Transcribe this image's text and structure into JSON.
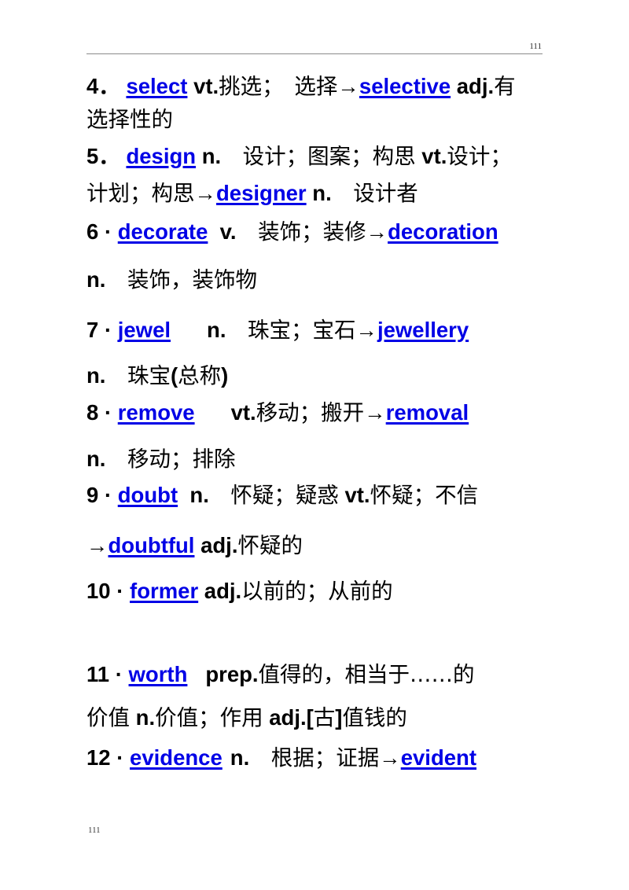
{
  "document": {
    "header": {
      "page_number": "111"
    },
    "footer": {
      "page_number": "111"
    },
    "colors": {
      "keyword_blue": "#0000e6",
      "text_black": "#000000",
      "rule_gray": "#8a8a8a"
    },
    "arrow_glyph": "→",
    "entries": [
      {
        "index": "4",
        "separator": "．",
        "headword": "select",
        "lines": [
          {
            "parts": [
              {
                "t": "num",
                "v": "4"
              },
              {
                "t": "sep",
                "v": "．"
              },
              {
                "t": "sp",
                "v": " "
              },
              {
                "t": "kw",
                "v": "select"
              },
              {
                "t": "sp",
                "v": " "
              },
              {
                "t": "pos",
                "v": "vt."
              },
              {
                "t": "cn",
                "v": "挑选；　选择"
              },
              {
                "t": "arr",
                "v": "→"
              },
              {
                "t": "kw",
                "v": "selective"
              },
              {
                "t": "sp",
                "v": " "
              },
              {
                "t": "pos",
                "v": "adj."
              },
              {
                "t": "cn",
                "v": "有"
              }
            ]
          },
          {
            "parts": [
              {
                "t": "cn",
                "v": "选择性的"
              }
            ]
          }
        ]
      },
      {
        "index": "5",
        "separator": "．",
        "headword": "design",
        "lines": [
          {
            "parts": [
              {
                "t": "num",
                "v": "5"
              },
              {
                "t": "sep",
                "v": "．"
              },
              {
                "t": "sp",
                "v": " "
              },
              {
                "t": "kw",
                "v": "design"
              },
              {
                "t": "sp",
                "v": " "
              },
              {
                "t": "pos",
                "v": "n."
              },
              {
                "t": "cn",
                "v": "　设计；图案；构思"
              },
              {
                "t": "sp",
                "v": " "
              },
              {
                "t": "pos",
                "v": "vt."
              },
              {
                "t": "cn",
                "v": "设计；"
              }
            ]
          },
          {
            "parts": [
              {
                "t": "cn",
                "v": "计划；构思"
              },
              {
                "t": "arr",
                "v": "→"
              },
              {
                "t": "kw",
                "v": "designer"
              },
              {
                "t": "sp",
                "v": " "
              },
              {
                "t": "pos",
                "v": "n."
              },
              {
                "t": "cn",
                "v": "　设计者"
              }
            ]
          }
        ]
      },
      {
        "index": "6",
        "separator": "·",
        "headword": "decorate",
        "lines": [
          {
            "parts": [
              {
                "t": "num",
                "v": "6"
              },
              {
                "t": "sp",
                "v": " "
              },
              {
                "t": "sep",
                "v": "·"
              },
              {
                "t": "sp",
                "v": " "
              },
              {
                "t": "kw",
                "v": "decorate"
              },
              {
                "t": "sp",
                "v": "  "
              },
              {
                "t": "pos",
                "v": "v."
              },
              {
                "t": "cn",
                "v": "　装饰；装修"
              },
              {
                "t": "arr",
                "v": "→"
              },
              {
                "t": "kw",
                "v": "decoration"
              }
            ]
          },
          {
            "parts": [
              {
                "t": "pos",
                "v": "n."
              },
              {
                "t": "cn",
                "v": "　装饰，装饰物"
              }
            ]
          }
        ]
      },
      {
        "index": "7",
        "separator": "·",
        "headword": "jewel",
        "lines": [
          {
            "parts": [
              {
                "t": "num",
                "v": "7"
              },
              {
                "t": "sp",
                "v": " "
              },
              {
                "t": "sep",
                "v": "·"
              },
              {
                "t": "sp",
                "v": " "
              },
              {
                "t": "kw",
                "v": "jewel"
              },
              {
                "t": "gapmd",
                "v": ""
              },
              {
                "t": "pos",
                "v": "n."
              },
              {
                "t": "cn",
                "v": "　珠宝；宝石"
              },
              {
                "t": "arr",
                "v": "→"
              },
              {
                "t": "kw",
                "v": "jewellery"
              }
            ]
          },
          {
            "parts": [
              {
                "t": "pos",
                "v": "n."
              },
              {
                "t": "cn",
                "v": "　珠宝"
              },
              {
                "t": "pos",
                "v": "("
              },
              {
                "t": "cn",
                "v": "总称"
              },
              {
                "t": "pos",
                "v": ")"
              }
            ]
          }
        ]
      },
      {
        "index": "8",
        "separator": "·",
        "headword": "remove",
        "lines": [
          {
            "parts": [
              {
                "t": "num",
                "v": "8"
              },
              {
                "t": "sp",
                "v": " "
              },
              {
                "t": "sep",
                "v": "·"
              },
              {
                "t": "sp",
                "v": " "
              },
              {
                "t": "kw",
                "v": "remove"
              },
              {
                "t": "gapmd",
                "v": ""
              },
              {
                "t": "pos",
                "v": "vt."
              },
              {
                "t": "cn",
                "v": "移动；搬开"
              },
              {
                "t": "arr",
                "v": "→"
              },
              {
                "t": "kw",
                "v": "removal"
              }
            ]
          },
          {
            "parts": [
              {
                "t": "pos",
                "v": "n."
              },
              {
                "t": "cn",
                "v": "　移动；排除"
              }
            ]
          }
        ]
      },
      {
        "index": "9",
        "separator": "·",
        "headword": "doubt",
        "lines": [
          {
            "parts": [
              {
                "t": "num",
                "v": "9"
              },
              {
                "t": "sp",
                "v": " "
              },
              {
                "t": "sep",
                "v": "·"
              },
              {
                "t": "sp",
                "v": " "
              },
              {
                "t": "kw",
                "v": "doubt"
              },
              {
                "t": "sp",
                "v": "  "
              },
              {
                "t": "pos",
                "v": "n."
              },
              {
                "t": "cn",
                "v": "　怀疑；疑惑"
              },
              {
                "t": "sp",
                "v": " "
              },
              {
                "t": "pos",
                "v": "vt."
              },
              {
                "t": "cn",
                "v": "怀疑；不信"
              }
            ]
          },
          {
            "parts": [
              {
                "t": "arr",
                "v": "→"
              },
              {
                "t": "kw",
                "v": "doubtful"
              },
              {
                "t": "sp",
                "v": " "
              },
              {
                "t": "pos",
                "v": "adj."
              },
              {
                "t": "cn",
                "v": "怀疑的"
              }
            ]
          }
        ]
      },
      {
        "index": "10",
        "separator": "·",
        "headword": "former",
        "lines": [
          {
            "parts": [
              {
                "t": "num",
                "v": "10"
              },
              {
                "t": "sp",
                "v": " "
              },
              {
                "t": "sep",
                "v": "·"
              },
              {
                "t": "sp",
                "v": " "
              },
              {
                "t": "kw",
                "v": "former"
              },
              {
                "t": "sp",
                "v": " "
              },
              {
                "t": "pos",
                "v": "adj."
              },
              {
                "t": "cn",
                "v": "以前的；从前的"
              }
            ]
          }
        ]
      },
      {
        "index": "11",
        "separator": "·",
        "headword": "worth",
        "lines": [
          {
            "parts": [
              {
                "t": "num",
                "v": "11"
              },
              {
                "t": "sp",
                "v": " "
              },
              {
                "t": "sep",
                "v": "·"
              },
              {
                "t": "sp",
                "v": " "
              },
              {
                "t": "kw",
                "v": "worth"
              },
              {
                "t": "sp",
                "v": "   "
              },
              {
                "t": "pos",
                "v": "prep."
              },
              {
                "t": "cn",
                "v": "值得的，相当于……的"
              }
            ]
          },
          {
            "parts": [
              {
                "t": "cn",
                "v": "价值"
              },
              {
                "t": "sp",
                "v": " "
              },
              {
                "t": "pos",
                "v": "n."
              },
              {
                "t": "cn",
                "v": "价值；作用"
              },
              {
                "t": "sp",
                "v": " "
              },
              {
                "t": "pos",
                "v": "adj.["
              },
              {
                "t": "cn",
                "v": "古"
              },
              {
                "t": "pos",
                "v": "]"
              },
              {
                "t": "cn",
                "v": "值钱的"
              }
            ]
          }
        ]
      },
      {
        "index": "12",
        "separator": "·",
        "headword": "evidence",
        "lines": [
          {
            "parts": [
              {
                "t": "num",
                "v": "12"
              },
              {
                "t": "sp",
                "v": " "
              },
              {
                "t": "sep",
                "v": "·"
              },
              {
                "t": "sp",
                "v": " "
              },
              {
                "t": "kw",
                "v": "evidence"
              },
              {
                "t": "gapsm",
                "v": ""
              },
              {
                "t": "pos",
                "v": "n."
              },
              {
                "t": "cn",
                "v": "　根据；证据"
              },
              {
                "t": "arr",
                "v": "→"
              },
              {
                "t": "kw",
                "v": "evident"
              }
            ]
          }
        ]
      }
    ]
  }
}
